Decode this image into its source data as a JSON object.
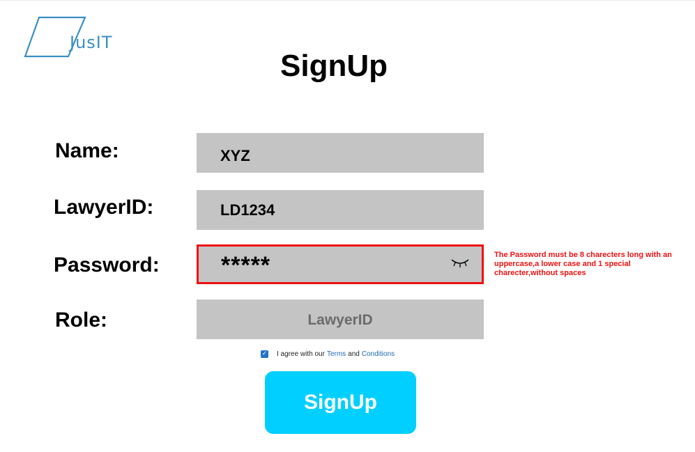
{
  "logo": {
    "text": "JusIT",
    "icon": "parallelogram-logo",
    "color": "#3a8fc4"
  },
  "page": {
    "title": "SignUp"
  },
  "form": {
    "name": {
      "label": "Name:",
      "value": "XYZ"
    },
    "lawyer_id": {
      "label": "LawyerID:",
      "value": "LD1234"
    },
    "password": {
      "label": "Password:",
      "value": "*****",
      "toggle_icon": "eye-closed-icon",
      "error": "The Password must be 8 charecters long with an uppercase,a lower case and 1 special charecter,without spaces",
      "error_color": "#ee1111"
    },
    "role": {
      "label": "Role:",
      "selected": "LawyerID"
    },
    "agree": {
      "checked": true,
      "text_before": "I agree with our",
      "terms_link": "Terms",
      "and": "and",
      "conditions_link": "Conditions"
    },
    "submit_label": "SignUp",
    "submit_color": "#00cfff",
    "field_bg": "#c4c4c4"
  }
}
